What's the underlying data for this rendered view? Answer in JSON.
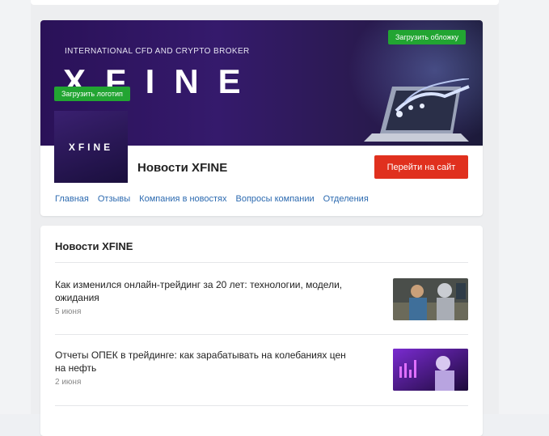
{
  "company": {
    "banner_subtitle": "INTERNATIONAL CFD AND CRYPTO BROKER",
    "banner_logo": "XFINE",
    "logo_text": "XFINE",
    "upload_cover_label": "Загрузить обложку",
    "upload_logo_label": "Загрузить логотип",
    "title": "Новости XFINE",
    "site_button_label": "Перейти на сайт",
    "nav": [
      {
        "label": "Главная"
      },
      {
        "label": "Отзывы"
      },
      {
        "label": "Компания в новостях"
      },
      {
        "label": "Вопросы компании"
      },
      {
        "label": "Отделения"
      }
    ]
  },
  "news": {
    "title": "Новости XFINE",
    "items": [
      {
        "headline": "Как изменился онлайн-трейдинг за 20 лет: технологии, модели, ожидания",
        "date": "5 июня"
      },
      {
        "headline": "Отчеты ОПЕК в трейдинге: как зарабатывать на колебаниях цен на нефть",
        "date": "2 июня"
      }
    ]
  },
  "colors": {
    "accent_green": "#22a532",
    "accent_red": "#e0301e",
    "link_blue": "#2c6ab0"
  }
}
